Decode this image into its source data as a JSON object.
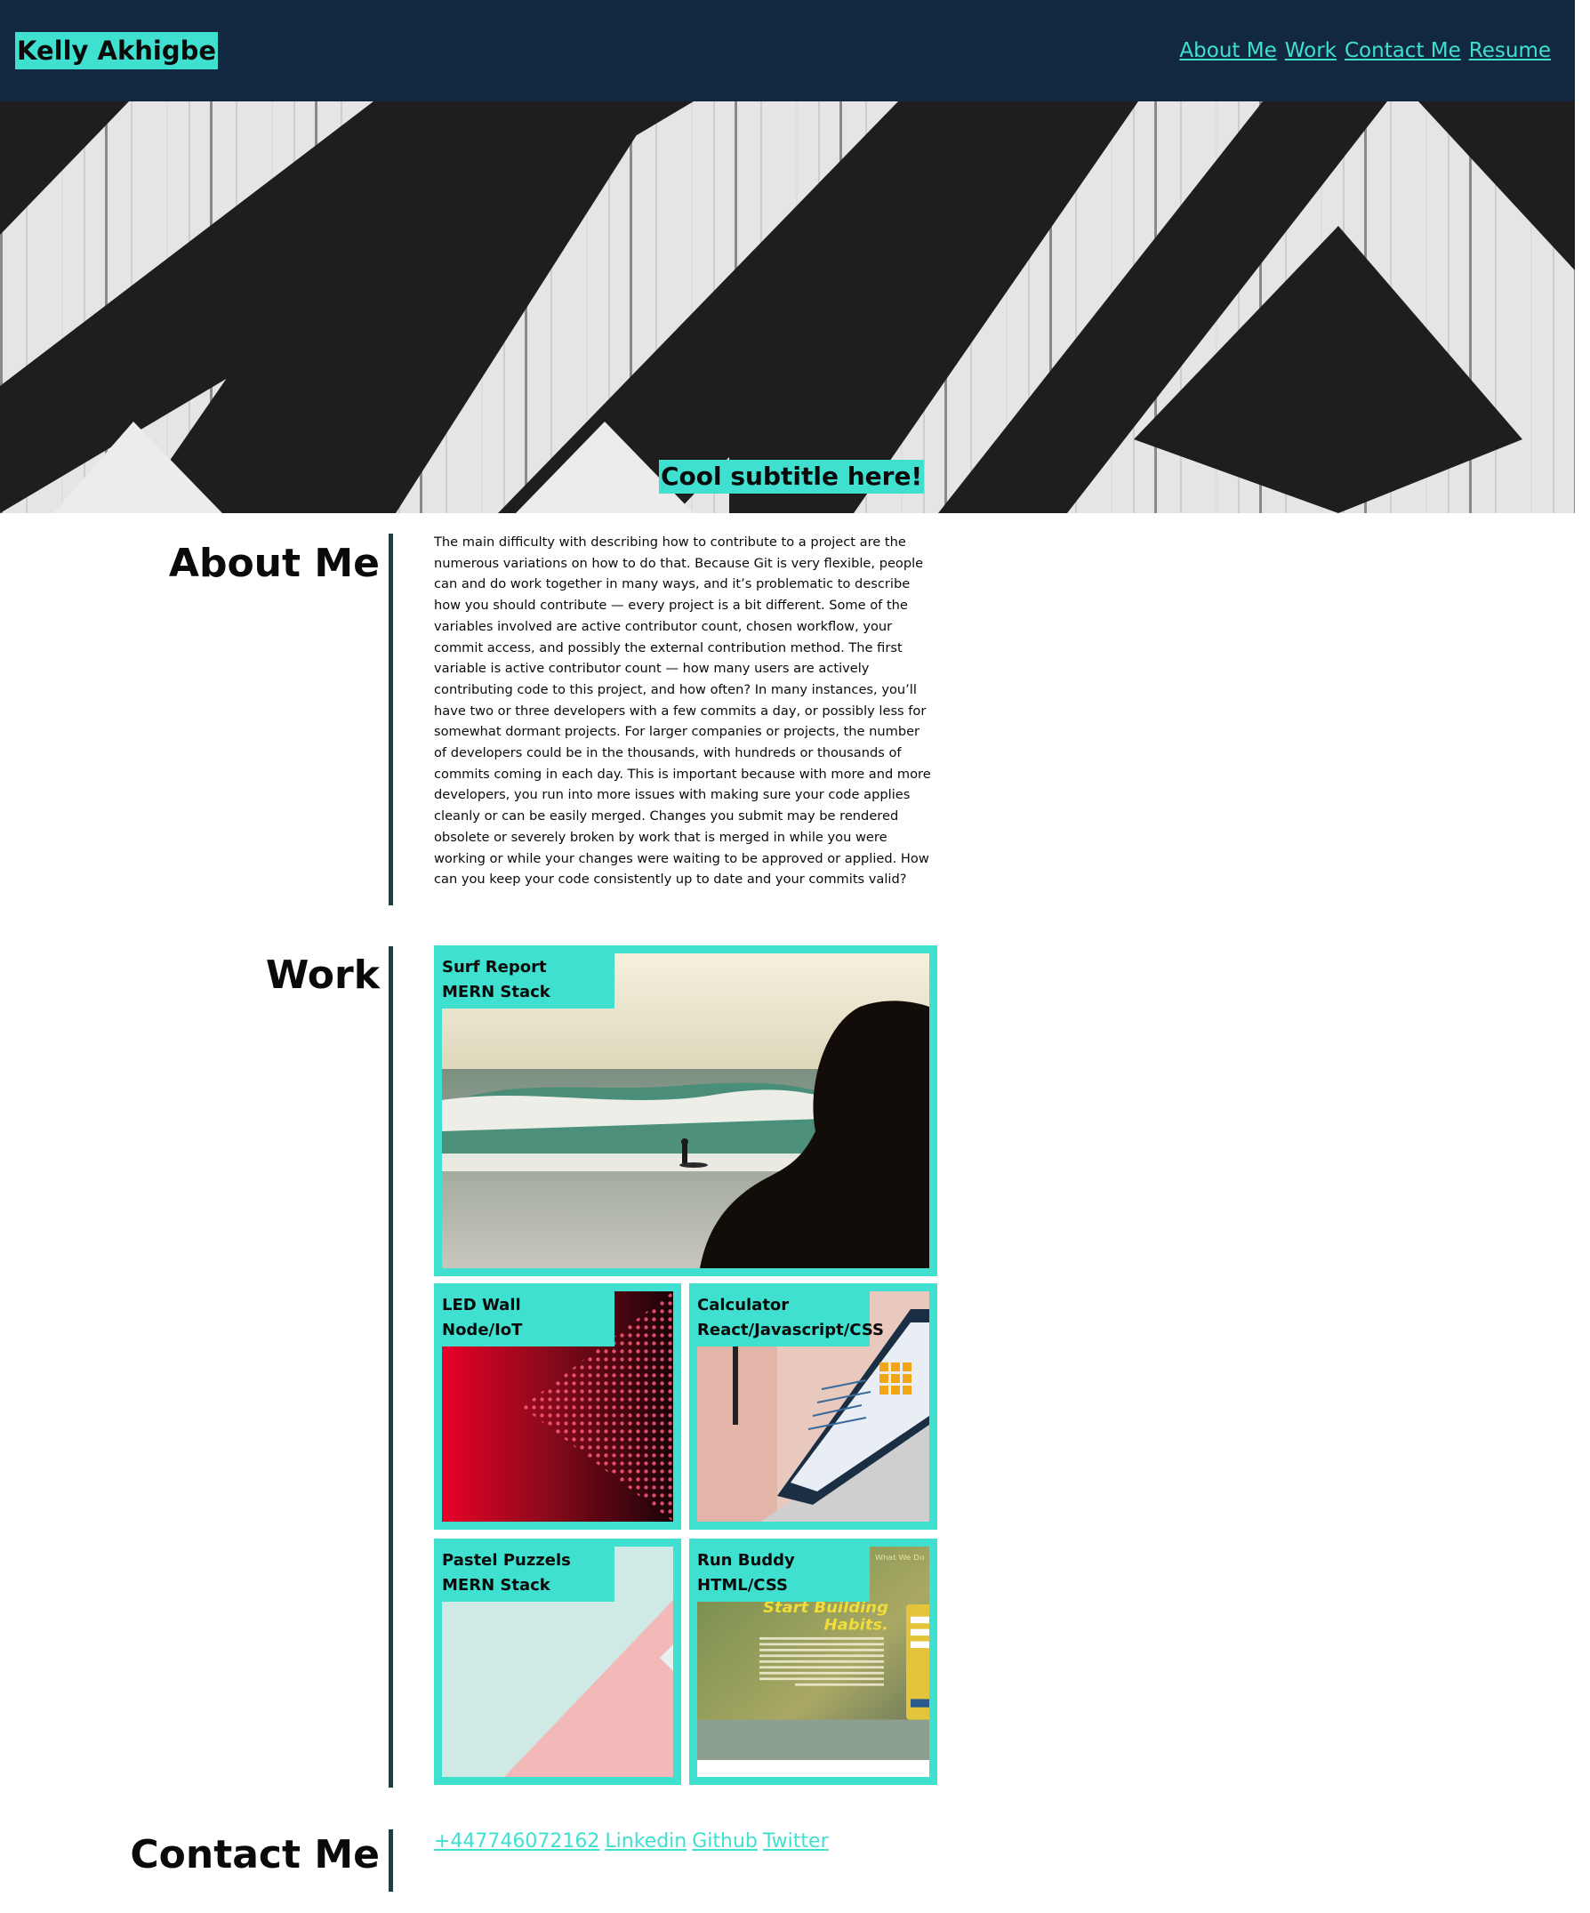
{
  "header": {
    "brand": "Kelly Akhigbe",
    "nav": [
      "About Me",
      "Work",
      "Contact Me",
      "Resume"
    ]
  },
  "hero": {
    "subtitle": "Cool subtitle here!"
  },
  "about": {
    "title": "About Me",
    "text": "The main difficulty with describing how to contribute to a project are the numerous variations on how to do that. Because Git is very flexible, people can and do work together in many ways, and it’s problematic to describe how you should contribute — every project is a bit different. Some of the variables involved are active contributor count, chosen workflow, your commit access, and possibly the external contribution method. The first variable is active contributor count — how many users are actively contributing code to this project, and how often? In many instances, you’ll have two or three developers with a few commits a day, or possibly less for somewhat dormant projects. For larger companies or projects, the number of developers could be in the thousands, with hundreds or thousands of commits coming in each day. This is important because with more and more developers, you run into more issues with making sure your code applies cleanly or can be easily merged. Changes you submit may be rendered obsolete or severely broken by work that is merged in while you were working or while your changes were waiting to be approved or applied. How can you keep your code consistently up to date and your commits valid?"
  },
  "work": {
    "title": "Work",
    "projects": [
      {
        "name": "Surf Report",
        "stack": "MERN Stack",
        "image": "surfer-at-sunset"
      },
      {
        "name": "LED Wall",
        "stack": "Node/IoT",
        "image": "red-led-wall"
      },
      {
        "name": "Calculator",
        "stack": "React/Javascript/CSS",
        "image": "laptop-with-code"
      },
      {
        "name": "Pastel Puzzels",
        "stack": "MERN Stack",
        "image": "pastel-pink-mint"
      },
      {
        "name": "Run Buddy",
        "stack": "HTML/CSS",
        "image": "run-buddy-site"
      }
    ],
    "run_buddy_shot": {
      "heading": [
        "Start Building",
        "Habits."
      ],
      "nav": "What We Do"
    }
  },
  "contact": {
    "title": "Contact Me",
    "links": [
      "+447746072162",
      "Linkedin",
      "Github",
      "Twitter"
    ]
  },
  "colors": {
    "header_bg": "#112840",
    "accent": "#3fe0d0",
    "divider": "#1d3f4b"
  }
}
